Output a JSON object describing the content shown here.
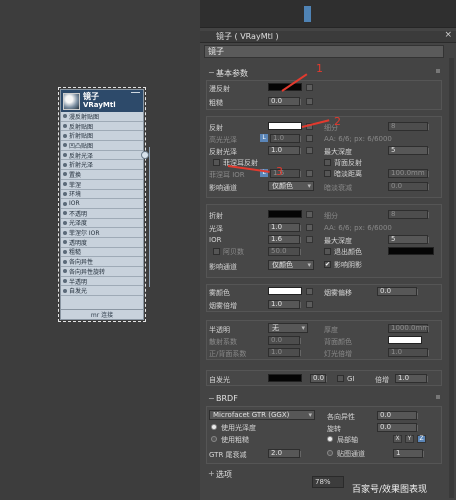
{
  "window": {
    "title": "镜子 ( VRayMtl )",
    "close": "×",
    "material_name": "镜子"
  },
  "node": {
    "title": "镜子",
    "subtitle": "VRayMtl",
    "slots": [
      "漫反射贴图",
      "反射贴图",
      "折射贴图",
      "凹凸贴图",
      "反射光泽",
      "折射光泽",
      "置换",
      "菲涅",
      "环境",
      "IOR",
      "不透明",
      "光泽度",
      "菲涅尔 IOR",
      "透明度",
      "粗糙",
      "各向异性",
      "各向异性旋转",
      "半透明",
      "自发光"
    ],
    "footer": "mr 连接"
  },
  "basic": {
    "header": "基本参数",
    "diffuse": "漫反射",
    "diffuse_color": "#050505",
    "roughness": "粗糙",
    "roughness_val": "0.0",
    "reflect": "反射",
    "reflect_color": "#ffffff",
    "subdivs": "细分",
    "subdivs_val": "8",
    "hilight": "高光光泽",
    "hilight_val": "1.0",
    "aa": "AA: 6/6; px: 6/6000",
    "refl_gloss": "反射光泽",
    "refl_gloss_val": "1.0",
    "max_depth": "最大深度",
    "max_depth_val": "5",
    "fresnel": "菲涅耳反射",
    "back_reflect": "背面反射",
    "fresnel_ior": "菲涅耳 IOR",
    "fresnel_ior_val": "1.6",
    "dim_distance": "暗淡距离",
    "dim_distance_val": "100.0mm",
    "affect_channels": "影响通道",
    "affect_channels_val": "仅颜色",
    "dim_falloff": "暗淡衰减",
    "dim_falloff_val": "0.0"
  },
  "refraction": {
    "refract": "折射",
    "refract_color": "#050505",
    "subdivs": "细分",
    "subdivs_val": "8",
    "glossiness": "光泽",
    "glossiness_val": "1.0",
    "aa": "AA: 6/6; px: 6/6000",
    "ior": "IOR",
    "ior_val": "1.6",
    "max_depth": "最大深度",
    "max_depth_val": "5",
    "abbe": "阿贝数",
    "abbe_val": "50.0",
    "exit_color": "退出颜色",
    "exit_color_val": "#050505",
    "affect_channels": "影响通道",
    "affect_channels_val": "仅颜色",
    "affect_shadows": "影响阴影"
  },
  "fog": {
    "fog_color": "雾颜色",
    "fog_color_val": "#ffffff",
    "fog_bias": "烟雾偏移",
    "fog_bias_val": "0.0",
    "fog_mult": "烟雾倍增",
    "fog_mult_val": "1.0"
  },
  "translucency": {
    "translucent": "半透明",
    "translucent_val": "无",
    "thickness": "厚度",
    "thickness_val": "1000.0mm",
    "scatter": "散射系数",
    "scatter_val": "0.0",
    "back_color": "背面颜色",
    "back_color_val": "#ffffff",
    "fwd_bck": "正/背面系数",
    "fwd_bck_val": "1.0",
    "light_mult": "灯光倍增",
    "light_mult_val": "1.0"
  },
  "selfillum": {
    "label": "自发光",
    "color": "#050505",
    "val": "0.0",
    "gi": "GI",
    "mult": "倍增",
    "mult_val": "1.0"
  },
  "brdf": {
    "header": "BRDF",
    "type_val": "Microfacet GTR (GGX)",
    "anisotropy": "各向异性",
    "anisotropy_val": "0.0",
    "use_gloss": "使用光泽度",
    "rotation": "旋转",
    "rotation_val": "0.0",
    "use_rough": "使用粗糙",
    "local_axis": "局部轴",
    "x": "X",
    "y": "Y",
    "z": "Z",
    "gtr": "GTR 尾衰减",
    "gtr_val": "2.0",
    "map_channel": "贴图通道",
    "map_channel_val": "1"
  },
  "next": {
    "header": "选项"
  },
  "annot": {
    "n1": "1",
    "n2": "2",
    "n3": "3"
  },
  "status": {
    "zoom": "78%",
    "watermark": "百家号/效果图表现"
  },
  "colors": {
    "accent": "#5b86b8",
    "annotation": "#e23a2e",
    "header": "#2d4a6a"
  }
}
